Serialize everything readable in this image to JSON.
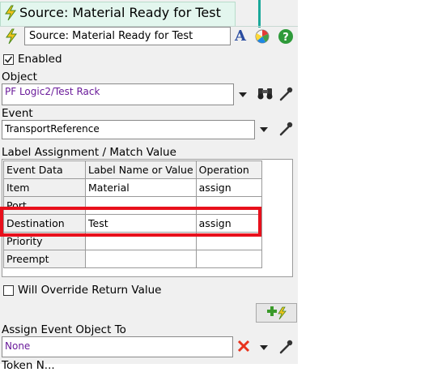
{
  "tab": {
    "title": "Source: Material Ready for Test"
  },
  "name_field": {
    "value": "Source: Material Ready for Test"
  },
  "enabled": {
    "label": "Enabled",
    "checked": true
  },
  "object": {
    "label": "Object",
    "value": "PF Logic2/Test Rack"
  },
  "event": {
    "label": "Event",
    "value": "TransportReference"
  },
  "label_assignment": {
    "title": "Label Assignment / Match Value",
    "columns": [
      "Event Data",
      "Label Name or Value",
      "Operation"
    ],
    "rows": [
      {
        "event_data": "Item",
        "label_value": "Material",
        "operation": "assign"
      },
      {
        "event_data": "Port",
        "label_value": "",
        "operation": ""
      },
      {
        "event_data": "Destination",
        "label_value": "Test",
        "operation": "assign"
      },
      {
        "event_data": "Priority",
        "label_value": "",
        "operation": ""
      },
      {
        "event_data": "Preempt",
        "label_value": "",
        "operation": ""
      }
    ]
  },
  "will_override": {
    "label": "Will Override Return Value",
    "checked": false
  },
  "assign_event": {
    "label": "Assign Event Object To",
    "value": "None"
  },
  "cut_label": {
    "text": "Token N..."
  },
  "colors": {
    "highlight": "#e8101c",
    "object_text": "#6a1b9a",
    "accent": "#1aa89a"
  }
}
